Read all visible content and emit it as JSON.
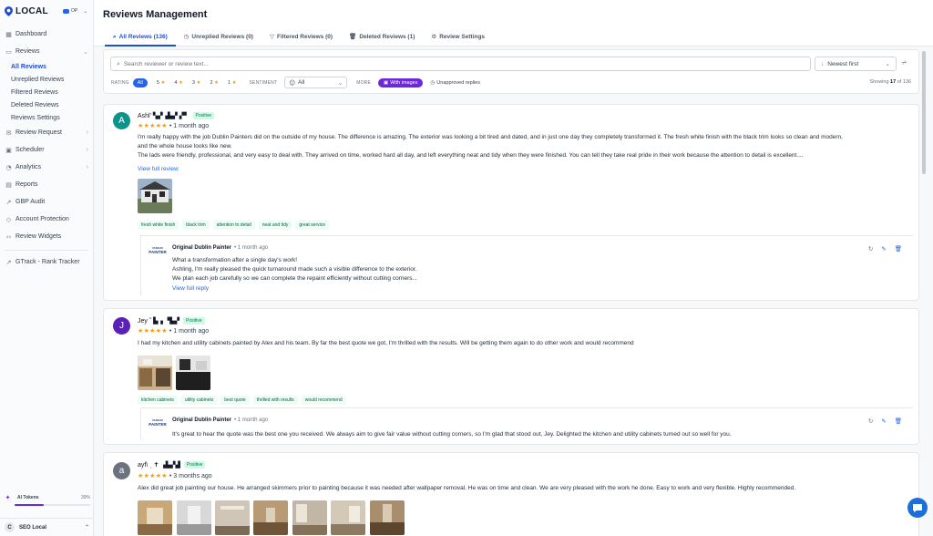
{
  "brand": {
    "name": "LOCAL",
    "account": "OP"
  },
  "sidebar": {
    "items": [
      {
        "label": "Dashboard",
        "icon": "dashboard-icon"
      },
      {
        "label": "Reviews",
        "icon": "reviews-icon"
      },
      {
        "label": "Review Request",
        "icon": "review-request-icon"
      },
      {
        "label": "Scheduler",
        "icon": "scheduler-icon"
      },
      {
        "label": "Analytics",
        "icon": "analytics-icon"
      },
      {
        "label": "Reports",
        "icon": "reports-icon"
      },
      {
        "label": "GBP Audit",
        "icon": "gbp-audit-icon"
      },
      {
        "label": "Account Protection",
        "icon": "shield-icon"
      },
      {
        "label": "Review Widgets",
        "icon": "code-icon"
      },
      {
        "label": "GTrack - Rank Tracker",
        "icon": "external-link-icon"
      }
    ],
    "reviews_sub": [
      "All Reviews",
      "Unreplied Reviews",
      "Filtered Reviews",
      "Deleted Reviews",
      "Reviews Settings"
    ],
    "tokens": {
      "label": "AI Tokens",
      "percent_text": "39%",
      "percent": 39
    },
    "footer": {
      "initial": "C",
      "label": "SEO Local"
    }
  },
  "page": {
    "title": "Reviews Management"
  },
  "tabs": [
    "All Reviews (136)",
    "Unreplied Reviews (0)",
    "Filtered Reviews (0)",
    "Deleted Reviews (1)",
    "Review Settings"
  ],
  "filters": {
    "search_placeholder": "Search reviewer or review text...",
    "sort_value": "Newest first",
    "rating_label": "RATING",
    "rating_all": "All",
    "rating_options": [
      "5",
      "4",
      "3",
      "2",
      "1"
    ],
    "sentiment_label": "SENTIMENT",
    "sentiment_value": "All",
    "more_label": "MORE",
    "with_images": "With images",
    "unapproved": "Unapproved replies",
    "showing_prefix": "Showing",
    "showing_count": "17",
    "showing_suffix": "of 136"
  },
  "colors": {
    "accent": "#2563eb",
    "purple": "#6d28d9",
    "star": "#f59e0b",
    "positive_bg": "#d1fae5",
    "positive_text": "#047857"
  },
  "reviews": [
    {
      "initial": "A",
      "avatar_color": "#0d9488",
      "name": "Ashl' ▚▞▗▙▞ ▞▘",
      "sentiment": "Positive",
      "stars": "★★★★★",
      "time": "• 1 month ago",
      "text_lines": [
        "I'm really happy with the job Dublin Painters did on the outside of my house. The difference is amazing. The exterior was looking a bit tired and dated, and in just one day they completely transformed it. The fresh white finish with the black trim looks so clean and modern,",
        "and the whole house looks like new.",
        "The lads were friendly, professional, and very easy to deal with. They arrived on time, worked hard all day, and left everything neat and tidy when they were finished. You can tell they take real pride in their work because the attention to detail is excellent...."
      ],
      "view_full": "View full review",
      "tags": [
        "fresh white finish",
        "black trim",
        "attention to detail",
        "neat and tidy",
        "great service"
      ],
      "reply": {
        "logo_top": "DUBLIN",
        "logo_bottom": "PAINTER",
        "author": "Original Dublin Painter",
        "time": "• 1 month ago",
        "lines": [
          "What a transformation after a single day's work!",
          "Ashling, I'm really pleased the quick turnaround made such a visible difference to the exterior.",
          "We plan each job carefully so we can complete the repaint efficiently without cutting corners..."
        ],
        "view_full": "View full reply"
      }
    },
    {
      "initial": "J",
      "avatar_color": "#5b21b6",
      "name": "Jey ˜ ▙▗ ▝▙▞",
      "sentiment": "Positive",
      "stars": "★★★★★",
      "time": "• 1 month ago",
      "text_lines": [
        "I had my kitchen and utility cabinets painted by Alex and his team. By far the best quote we got, I'm thrilled with the results. Will be getting them again to do other work and would recommend"
      ],
      "tags": [
        "kitchen cabinets",
        "utility cabinets",
        "best quote",
        "thrilled with results",
        "would recommend"
      ],
      "reply": {
        "logo_top": "DUBLIN",
        "logo_bottom": "PAINTER",
        "author": "Original Dublin Painter",
        "time": "• 1 month ago",
        "lines": [
          "It's great to hear the quote was the best one you received. We always aim to give fair value without cutting corners, so I'm glad that stood out, Jey. Delighted the kitchen and utility cabinets turned out so well for you."
        ]
      }
    },
    {
      "initial": "a",
      "avatar_color": "#6b7280",
      "name": "ayf\\ ˌ ✝ ▗▙▞▟",
      "sentiment": "Positive",
      "stars": "★★★★★",
      "time": "• 3 months ago",
      "text_lines": [
        "Alex did great job painting our house. He arranged skimmers prior to painting because it was needed after wallpaper removal. He was on time and clean. We are very pleased with the work he done. Easy to work and very flexible. Highly recommended."
      ]
    }
  ]
}
